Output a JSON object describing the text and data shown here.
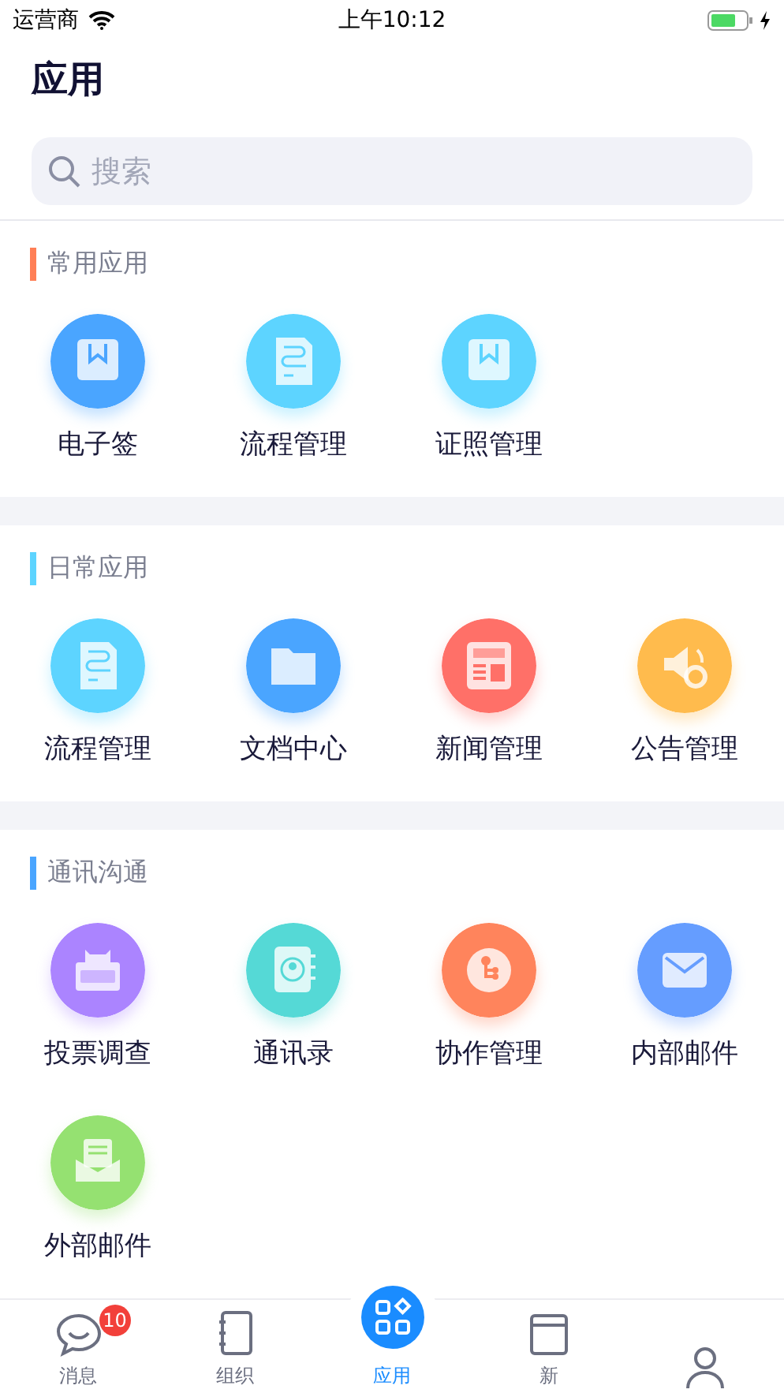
{
  "status_bar": {
    "carrier": "运营商",
    "time": "上午10:12"
  },
  "header": {
    "title": "应用"
  },
  "search": {
    "placeholder": "搜索"
  },
  "sections": [
    {
      "title": "常用应用",
      "color": "#ff7f56",
      "items": [
        {
          "label": "电子签",
          "kind": "bookmark",
          "color": "#4aa5ff"
        },
        {
          "label": "流程管理",
          "kind": "flow",
          "color": "#5dd4ff"
        },
        {
          "label": "证照管理",
          "kind": "bookmark",
          "color": "#5dd4ff"
        }
      ]
    },
    {
      "title": "日常应用",
      "color": "#5dd4ff",
      "items": [
        {
          "label": "流程管理",
          "kind": "flow",
          "color": "#5dd4ff"
        },
        {
          "label": "文档中心",
          "kind": "folder",
          "color": "#4aa5ff"
        },
        {
          "label": "新闻管理",
          "kind": "news",
          "color": "#ff7068"
        },
        {
          "label": "公告管理",
          "kind": "speaker",
          "color": "#ffbb4d"
        }
      ]
    },
    {
      "title": "通讯沟通",
      "color": "#4aa5ff",
      "items": [
        {
          "label": "投票调查",
          "kind": "vote",
          "color": "#ab84ff"
        },
        {
          "label": "通讯录",
          "kind": "contacts",
          "color": "#55d9d6"
        },
        {
          "label": "协作管理",
          "kind": "branch",
          "color": "#ff845c"
        },
        {
          "label": "内部邮件",
          "kind": "mail",
          "color": "#659dff"
        },
        {
          "label": "外部邮件",
          "kind": "openmail",
          "color": "#95e171"
        }
      ]
    }
  ],
  "tab_bar": [
    {
      "label": "消息",
      "kind": "chat",
      "selected": false,
      "badge": "10"
    },
    {
      "label": "组织",
      "kind": "notebook",
      "selected": false
    },
    {
      "label": "应用",
      "kind": "apps",
      "selected": true
    },
    {
      "label": "新",
      "kind": "window",
      "selected": false
    },
    {
      "kind": "person",
      "selected": false
    }
  ]
}
